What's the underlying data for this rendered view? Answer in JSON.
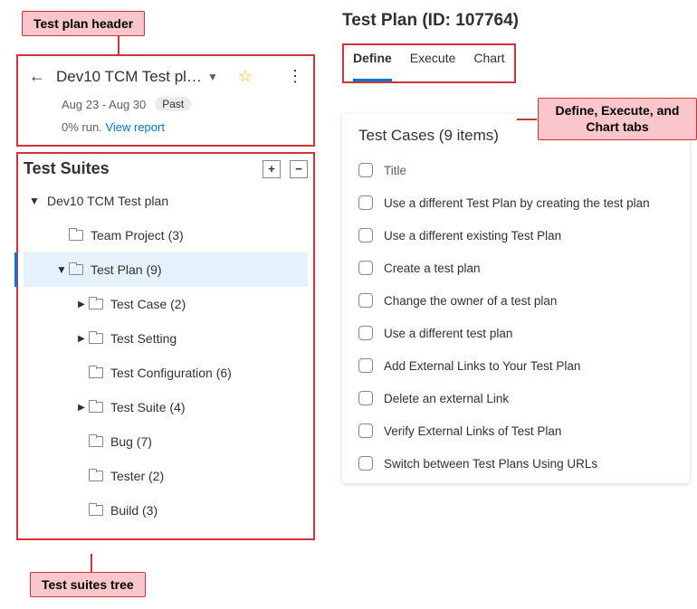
{
  "callouts": {
    "header": "Test plan header",
    "tabs": "Define, Execute,\nand Chart tabs",
    "tree": "Test suites tree"
  },
  "plan_header": {
    "name": "Dev10 TCM Test pl…",
    "date_range": "Aug 23 - Aug 30",
    "past_badge": "Past",
    "run_status": "0% run.",
    "view_report": "View report"
  },
  "suites": {
    "title": "Test Suites",
    "root": {
      "label": "Dev10 TCM Test plan",
      "expanded": true
    },
    "items": [
      {
        "label": "Team Project (3)",
        "depth": 1,
        "twisty": "",
        "selected": false
      },
      {
        "label": "Test Plan (9)",
        "depth": 1,
        "twisty": "down",
        "selected": true
      },
      {
        "label": "Test Case (2)",
        "depth": 2,
        "twisty": "right",
        "selected": false
      },
      {
        "label": "Test Setting",
        "depth": 2,
        "twisty": "right",
        "selected": false
      },
      {
        "label": "Test Configuration (6)",
        "depth": 2,
        "twisty": "",
        "selected": false
      },
      {
        "label": "Test Suite (4)",
        "depth": 2,
        "twisty": "right",
        "selected": false
      },
      {
        "label": "Bug (7)",
        "depth": 2,
        "twisty": "",
        "selected": false
      },
      {
        "label": "Tester (2)",
        "depth": 2,
        "twisty": "",
        "selected": false
      },
      {
        "label": "Build (3)",
        "depth": 2,
        "twisty": "",
        "selected": false
      }
    ]
  },
  "right": {
    "title": "Test Plan (ID: 107764)",
    "tabs": [
      {
        "label": "Define",
        "active": true
      },
      {
        "label": "Execute",
        "active": false
      },
      {
        "label": "Chart",
        "active": false
      }
    ],
    "cases_title": "Test Cases (9 items)",
    "column_header": "Title",
    "cases": [
      "Use a different Test Plan by creating the test plan",
      "Use a different existing Test Plan",
      "Create a test plan",
      "Change the owner of a test plan",
      "Use a different test plan",
      "Add External Links to Your Test Plan",
      "Delete an external Link",
      "Verify External Links of Test Plan",
      "Switch between Test Plans Using URLs"
    ]
  }
}
